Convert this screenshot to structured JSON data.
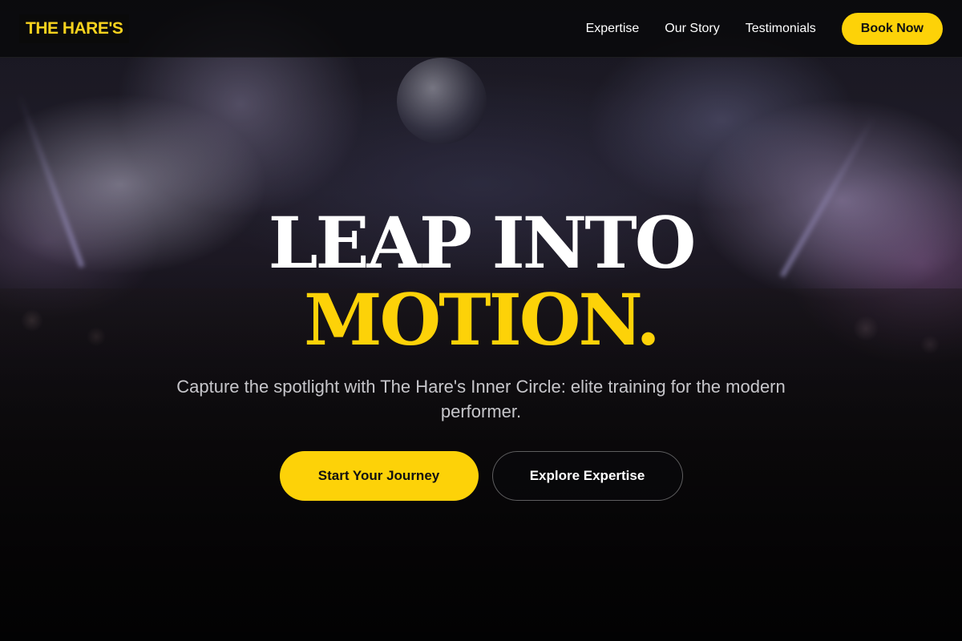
{
  "header": {
    "logo_text": "THE HARE'S",
    "nav": [
      {
        "label": "Expertise"
      },
      {
        "label": "Our Story"
      },
      {
        "label": "Testimonials"
      }
    ],
    "cta_label": "Book Now"
  },
  "hero": {
    "headline_line1": "LEAP INTO",
    "headline_line2": "MOTION.",
    "subtitle": "Capture the spotlight with The Hare's Inner Circle: elite training for the modern performer.",
    "primary_cta": "Start Your Journey",
    "secondary_cta": "Explore Expertise"
  },
  "colors": {
    "accent": "#fdd208",
    "header_bg": "#08080a",
    "text": "#ffffff"
  }
}
